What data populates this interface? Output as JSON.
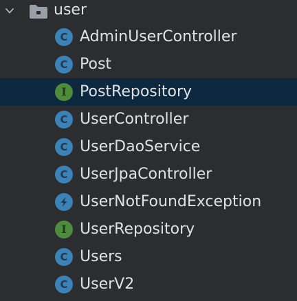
{
  "folder": {
    "name": "user",
    "expanded": true,
    "icon": "folder-icon",
    "chevron_icon": "chevron-down-icon"
  },
  "items": [
    {
      "label": "AdminUserController",
      "kind": "class",
      "icon": "class-icon",
      "glyph": "C",
      "selected": false
    },
    {
      "label": "Post",
      "kind": "class",
      "icon": "class-icon",
      "glyph": "C",
      "selected": false
    },
    {
      "label": "PostRepository",
      "kind": "interface",
      "icon": "interface-icon",
      "glyph": "I",
      "selected": true
    },
    {
      "label": "UserController",
      "kind": "class",
      "icon": "class-icon",
      "glyph": "C",
      "selected": false
    },
    {
      "label": "UserDaoService",
      "kind": "class",
      "icon": "class-icon",
      "glyph": "C",
      "selected": false
    },
    {
      "label": "UserJpaController",
      "kind": "class",
      "icon": "class-icon",
      "glyph": "C",
      "selected": false
    },
    {
      "label": "UserNotFoundException",
      "kind": "exception",
      "icon": "exception-class-icon",
      "glyph": "⚡",
      "selected": false
    },
    {
      "label": "UserRepository",
      "kind": "interface",
      "icon": "interface-icon",
      "glyph": "I",
      "selected": false
    },
    {
      "label": "Users",
      "kind": "class",
      "icon": "class-icon",
      "glyph": "C",
      "selected": false
    },
    {
      "label": "UserV2",
      "kind": "class",
      "icon": "class-icon",
      "glyph": "C",
      "selected": false
    }
  ],
  "colors": {
    "background": "#2b2d30",
    "selection": "#0e293f",
    "text": "#dfe1e5",
    "class_icon": "#3d82b7",
    "interface_icon": "#4f8b3d"
  }
}
